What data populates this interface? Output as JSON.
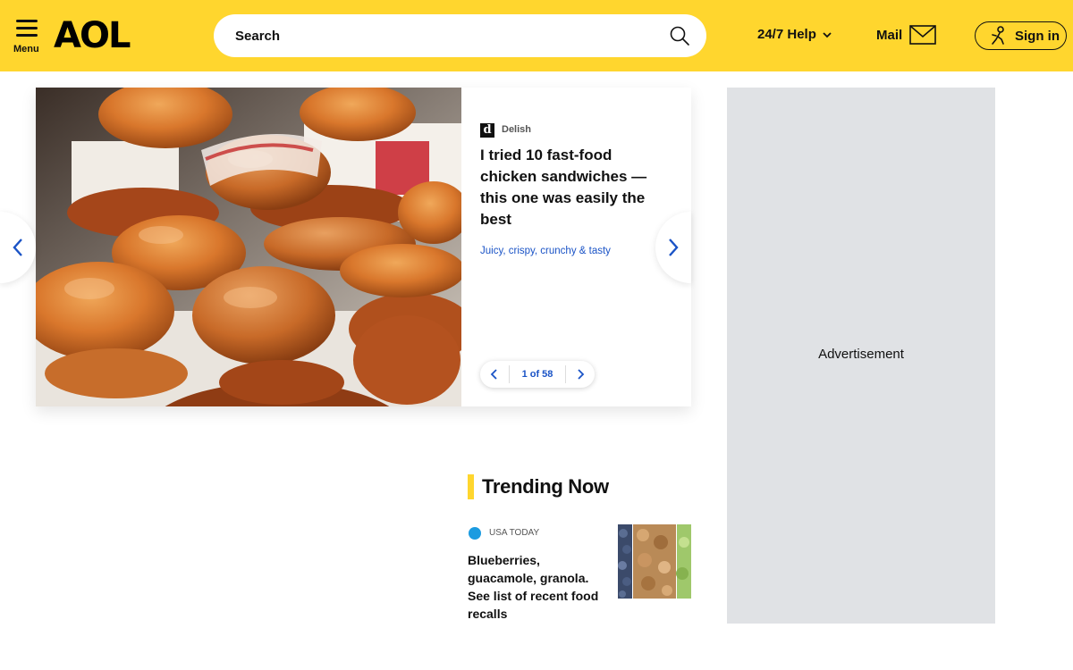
{
  "header": {
    "menu_label": "Menu",
    "logo_text": "AOL",
    "search_placeholder": "Search",
    "help_label": "24/7 Help",
    "mail_label": "Mail",
    "signin_label": "Sign in",
    "accent_color": "#ffd62e"
  },
  "hero": {
    "source": "Delish",
    "source_logo_letter": "d",
    "headline": "I tried 10 fast-food chicken sandwiches — this one was easily the best",
    "subhead": "Juicy, crispy, crunchy & tasty",
    "pager_text": "1 of 58",
    "link_color": "#1a53c6"
  },
  "ad": {
    "label": "Advertisement"
  },
  "trending": {
    "title": "Trending Now",
    "items": [
      {
        "source": "USA TODAY",
        "headline": "Blueberries, guacamole, granola. See list of recent food recalls"
      }
    ]
  }
}
